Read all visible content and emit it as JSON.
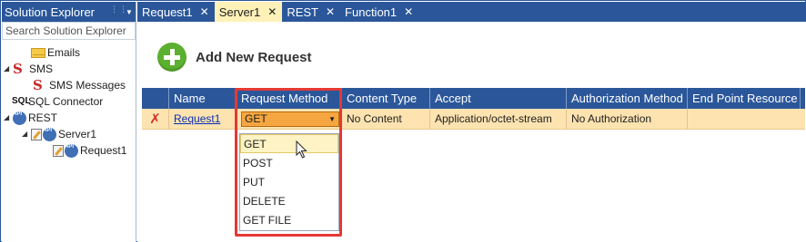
{
  "solution_explorer": {
    "title": "Solution Explorer",
    "search_placeholder": "Search Solution Explorer",
    "tree": [
      {
        "label": "Emails",
        "icon": "mail-icon"
      },
      {
        "label": "SMS",
        "icon": "sms-icon"
      },
      {
        "label": "SMS Messages",
        "icon": "sms-icon"
      },
      {
        "label": "SQL Connector",
        "icon": "sql-icon"
      },
      {
        "label": "REST",
        "icon": "api-icon"
      },
      {
        "label": "Server1",
        "icon": "api-icon"
      },
      {
        "label": "Request1",
        "icon": "api-icon"
      }
    ]
  },
  "tabs": [
    {
      "label": "Request1",
      "close": "✕",
      "active": false
    },
    {
      "label": "Server1",
      "close": "✕",
      "active": true
    },
    {
      "label": "REST",
      "close": "✕",
      "active": false
    },
    {
      "label": "Function1",
      "close": "✕",
      "active": false
    }
  ],
  "toolbar": {
    "add_label": "Add New Request"
  },
  "grid": {
    "columns": [
      "",
      "Name",
      "Request Method",
      "Content Type",
      "Accept",
      "Authorization Method",
      "End Point Resource"
    ],
    "rows": [
      {
        "delete": "✗",
        "name": "Request1",
        "method": "GET",
        "content_type": "No Content",
        "accept": "Application/octet-stream",
        "auth": "No Authorization",
        "endpoint": ""
      }
    ]
  },
  "method_dropdown": {
    "selected": "GET",
    "options": [
      "GET",
      "POST",
      "PUT",
      "DELETE",
      "GET FILE"
    ]
  },
  "colors": {
    "accent": "#2b579a",
    "row_highlight": "#fde3b0",
    "callout": "#e53935",
    "select": "#f6a640"
  }
}
